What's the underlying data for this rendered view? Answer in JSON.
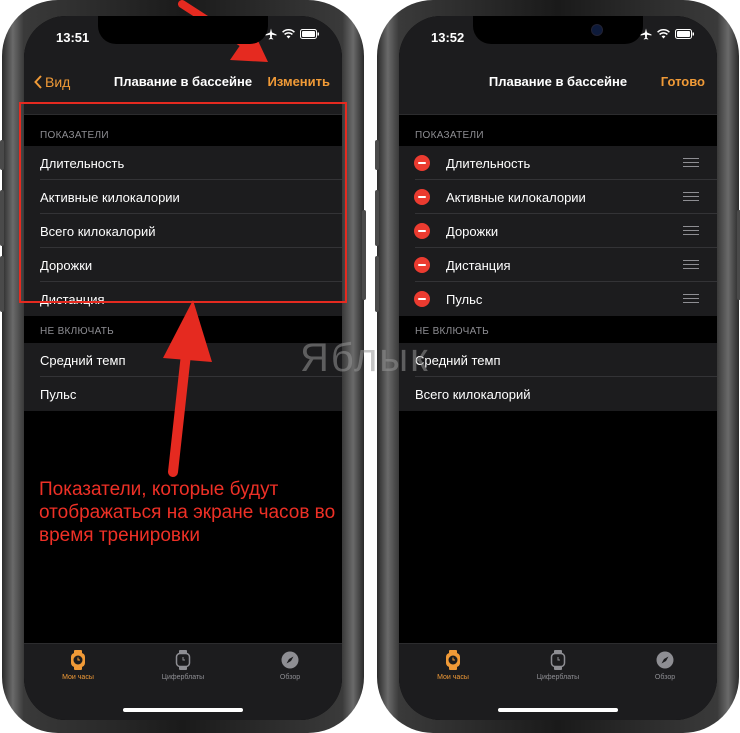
{
  "left_phone": {
    "status_time": "13:51",
    "nav": {
      "back_label": "Вид",
      "title": "Плавание в бассейне",
      "action_label": "Изменить"
    },
    "section_metrics": {
      "header": "ПОКАЗАТЕЛИ",
      "items": [
        "Длительность",
        "Активные килокалории",
        "Всего килокалорий",
        "Дорожки",
        "Дистанция"
      ]
    },
    "section_excluded": {
      "header": "НЕ ВКЛЮЧАТЬ",
      "items": [
        "Средний темп",
        "Пульс"
      ]
    }
  },
  "right_phone": {
    "status_time": "13:52",
    "nav": {
      "title": "Плавание в бассейне",
      "action_label": "Готово"
    },
    "section_metrics": {
      "header": "ПОКАЗАТЕЛИ",
      "items": [
        "Длительность",
        "Активные килокалории",
        "Дорожки",
        "Дистанция",
        "Пульс"
      ]
    },
    "section_excluded": {
      "header": "НЕ ВКЛЮЧАТЬ",
      "items": [
        "Средний темп",
        "Всего килокалорий"
      ]
    }
  },
  "tabbar": {
    "tabs": [
      {
        "label": "Мои часы",
        "icon": "watch-active-icon",
        "active": true
      },
      {
        "label": "Циферблаты",
        "icon": "watch-face-icon",
        "active": false
      },
      {
        "label": "Обзор",
        "icon": "compass-icon",
        "active": false
      }
    ]
  },
  "annotation": {
    "text": "Показатели, которые будут отображаться на экране часов во время тренировки"
  },
  "watermark": "Яблык",
  "colors": {
    "accent": "#f09a37",
    "annotation_red": "#e52a20",
    "delete_red": "#eb3b30",
    "cell_bg": "#1c1c1e"
  }
}
